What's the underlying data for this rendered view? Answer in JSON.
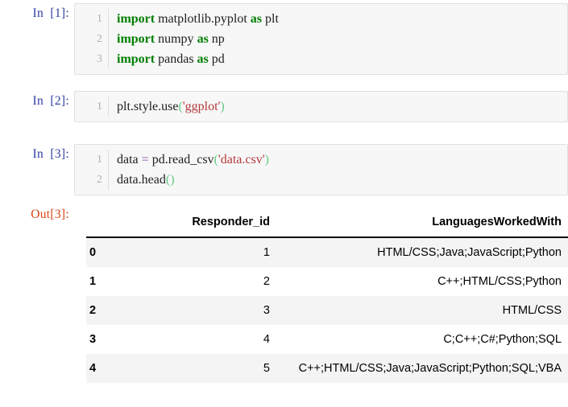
{
  "notebook": {
    "cells": [
      {
        "prompt": "In  [1]:",
        "lines": [
          "1",
          "2",
          "3"
        ],
        "line1_kw": "import",
        "line1_mod": " matplotlib.pyplot ",
        "line1_as": "as",
        "line1_alias": " plt",
        "line2_kw": "import",
        "line2_mod": " numpy ",
        "line2_as": "as",
        "line2_alias": " np",
        "line3_kw": "import",
        "line3_mod": " pandas ",
        "line3_as": "as",
        "line3_alias": " pd",
        "source_text": "import matplotlib.pyplot as plt\nimport numpy as np\nimport pandas as pd"
      },
      {
        "prompt": "In  [2]:",
        "lines": [
          "1"
        ],
        "call": "plt.style.use",
        "open_paren": "(",
        "string": "'ggplot'",
        "close_paren": ")",
        "source_text": "plt.style.use('ggplot')"
      },
      {
        "prompt": "In  [3]:",
        "lines": [
          "1",
          "2"
        ],
        "var": "data ",
        "assign": "=",
        "call": " pd.read_csv",
        "open_paren": "(",
        "string": "'data.csv'",
        "close_paren": ")",
        "line2_call": "data.head",
        "line2_parens": "()",
        "source_text": "data = pd.read_csv('data.csv')\ndata.head()"
      }
    ],
    "output": {
      "prompt": "Out[3]:",
      "table": {
        "index_header": "",
        "headers": [
          "Responder_id",
          "LanguagesWorkedWith"
        ],
        "rows": [
          {
            "index": "0",
            "responder_id": "1",
            "languages": "HTML/CSS;Java;JavaScript;Python"
          },
          {
            "index": "1",
            "responder_id": "2",
            "languages": "C++;HTML/CSS;Python"
          },
          {
            "index": "2",
            "responder_id": "3",
            "languages": "HTML/CSS"
          },
          {
            "index": "3",
            "responder_id": "4",
            "languages": "C;C++;C#;Python;SQL"
          },
          {
            "index": "4",
            "responder_id": "5",
            "languages": "C++;HTML/CSS;Java;JavaScript;Python;SQL;VBA"
          }
        ]
      }
    }
  },
  "colors": {
    "keyword_green": "#007f00",
    "string_red": "#b5393b",
    "operator_purple": "#7b3fa0",
    "in_prompt_blue": "#303f9f",
    "out_prompt_red": "#d84315",
    "cell_background": "#f7f7f7",
    "cell_border": "#e0e0e0",
    "row_stripe": "#f4f4f4"
  }
}
